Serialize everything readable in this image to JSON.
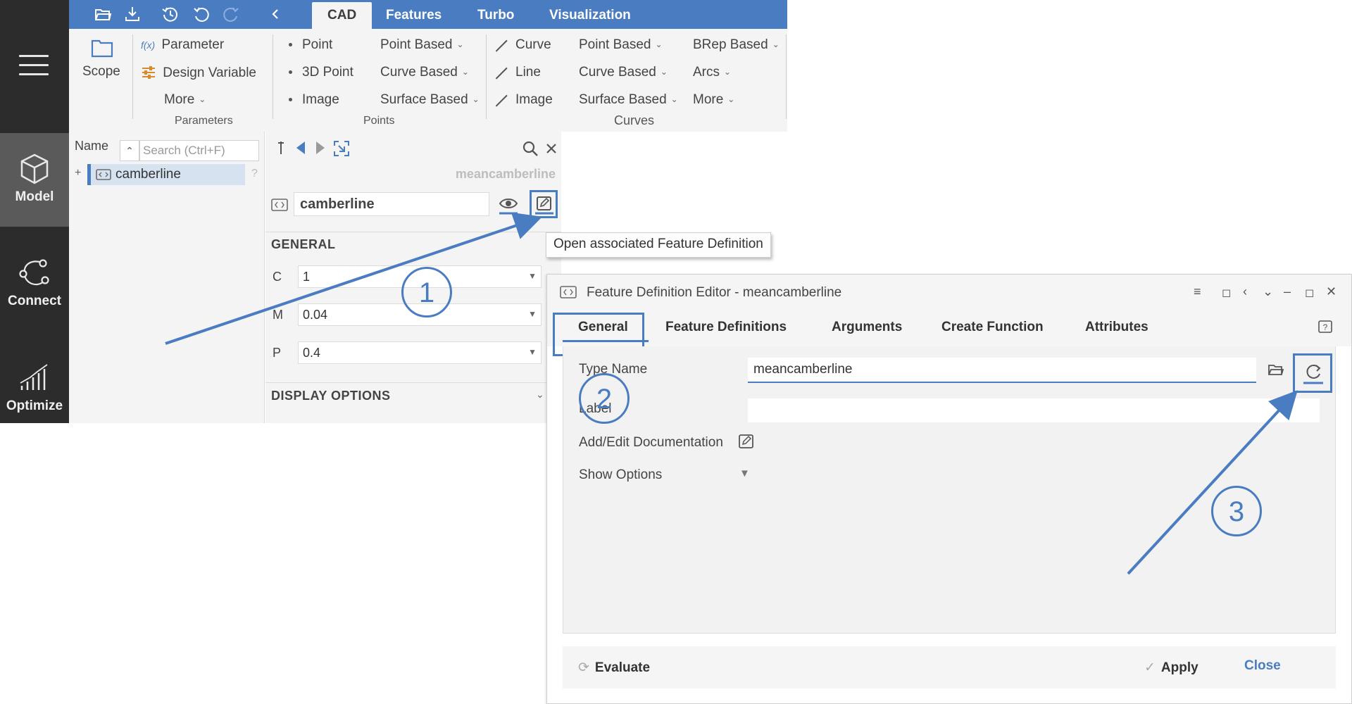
{
  "nav": {
    "items": [
      {
        "label": "Model",
        "icon": "cube-icon",
        "active": true
      },
      {
        "label": "Connect",
        "icon": "connect-nodes-icon",
        "active": false
      },
      {
        "label": "Optimize",
        "icon": "bar-chart-icon",
        "active": false
      }
    ]
  },
  "topbar": {
    "quick_icons": [
      "folder-open-icon",
      "download-icon",
      "history-icon",
      "undo-icon",
      "redo-icon",
      "back-chevron-icon"
    ],
    "tabs": [
      {
        "label": "CAD",
        "active": true
      },
      {
        "label": "Features",
        "active": false
      },
      {
        "label": "Turbo",
        "active": false
      },
      {
        "label": "Visualization",
        "active": false
      }
    ]
  },
  "ribbon": {
    "scope_label": "Scope",
    "parameters": {
      "parameter_fx": "f(x)",
      "parameter": "Parameter",
      "design_variable": "Design Variable",
      "more": "More",
      "group": "Parameters"
    },
    "points": {
      "point": "Point",
      "point3d": "3D Point",
      "image": "Image",
      "point_based": "Point Based",
      "curve_based": "Curve Based",
      "surface_based": "Surface Based",
      "group": "Points"
    },
    "curves": {
      "curve": "Curve",
      "line": "Line",
      "image": "Image",
      "point_based": "Point Based",
      "curve_based": "Curve Based",
      "surface_based": "Surface Based",
      "brep_based": "BRep Based",
      "arcs": "Arcs",
      "more": "More",
      "group": "Curves"
    }
  },
  "tree": {
    "name_header": "Name",
    "search_placeholder": "Search (Ctrl+F)",
    "items": [
      {
        "label": "camberline",
        "expander": "+",
        "help": "?"
      }
    ]
  },
  "properties": {
    "subtitle": "meancamberline",
    "name_value": "camberline",
    "general_title": "GENERAL",
    "params": [
      {
        "label": "C",
        "value": "1"
      },
      {
        "label": "M",
        "value": "0.04"
      },
      {
        "label": "P",
        "value": "0.4"
      }
    ],
    "display_title": "DISPLAY OPTIONS"
  },
  "tooltip": {
    "text": "Open associated Feature Definition"
  },
  "dialog": {
    "title": "Feature Definition Editor - meancamberline",
    "tabs": [
      {
        "label": "General",
        "active": true
      },
      {
        "label": "Feature Definitions",
        "active": false
      },
      {
        "label": "Arguments",
        "active": false
      },
      {
        "label": "Create Function",
        "active": false
      },
      {
        "label": "Attributes",
        "active": false
      }
    ],
    "type_name_label": "Type Name",
    "type_name_value": "meancamberline",
    "label_label": "Label",
    "label_value": "",
    "add_edit_doc": "Add/Edit Documentation",
    "show_options": "Show Options",
    "evaluate": "Evaluate",
    "apply": "Apply",
    "close": "Close"
  },
  "annotations": {
    "step1": "1",
    "step2": "2",
    "step3": "3"
  },
  "colors": {
    "accent": "#4a7cc1",
    "nav_bg": "#2c2c2c",
    "nav_active": "#5a5a5a",
    "panel_bg": "#f4f4f4"
  }
}
